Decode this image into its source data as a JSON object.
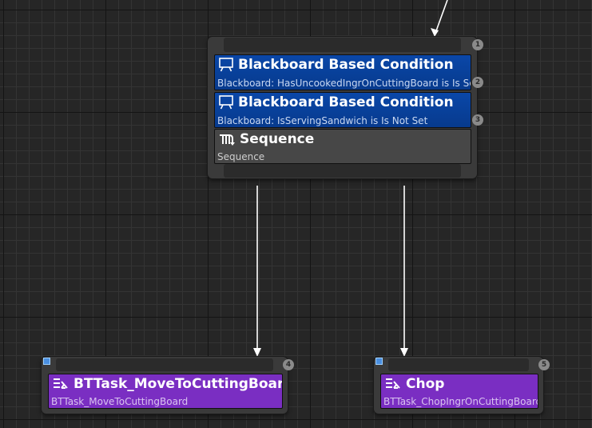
{
  "graph": {
    "root_node": {
      "index": "1",
      "decorators": [
        {
          "index": "2",
          "title": "Blackboard Based Condition",
          "subtitle": "Blackboard: HasUncookedIngrOnCuttingBoard is Is Set",
          "icon": "blackboard-condition-icon"
        },
        {
          "index": "3",
          "title": "Blackboard Based Condition",
          "subtitle": "Blackboard: IsServingSandwich is Is Not Set",
          "icon": "blackboard-condition-icon"
        }
      ],
      "composite": {
        "title": "Sequence",
        "subtitle": "Sequence",
        "icon": "sequence-icon"
      }
    },
    "tasks": [
      {
        "index": "4",
        "title": "BTTask_MoveToCuttingBoard",
        "subtitle": "BTTask_MoveToCuttingBoard",
        "icon": "task-icon"
      },
      {
        "index": "5",
        "title": "Chop",
        "subtitle": "BTTask_ChopIngrOnCuttingBoard",
        "icon": "task-icon"
      }
    ],
    "colors": {
      "decorator": "#0a47a8",
      "composite": "#474747",
      "task": "#7a2ec2",
      "wire": "#ffffff",
      "node_frame": "#3a3a3a"
    }
  }
}
